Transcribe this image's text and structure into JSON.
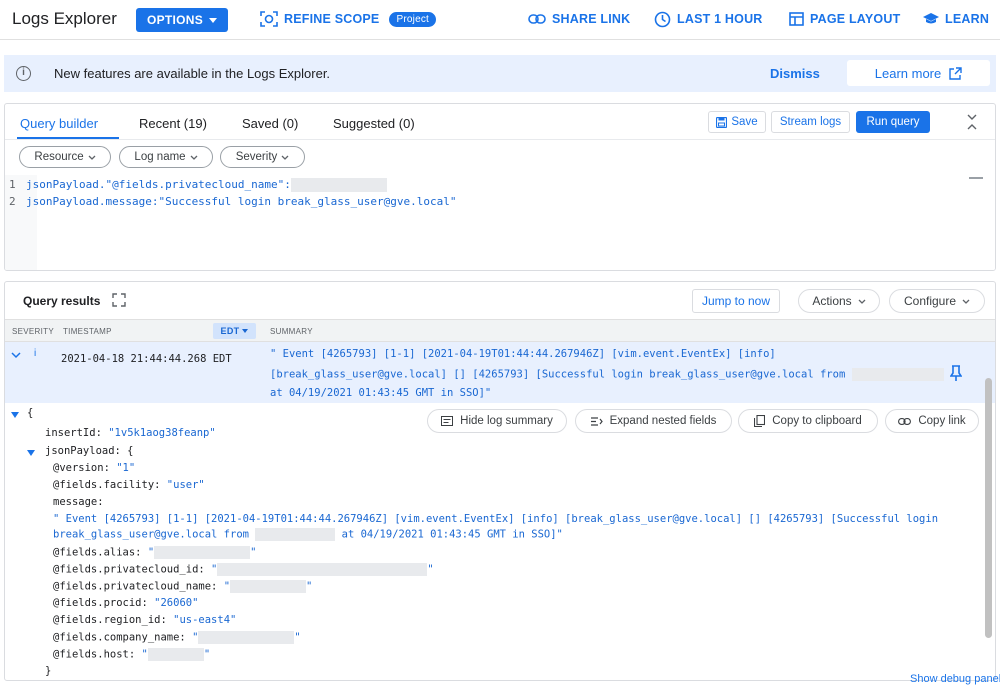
{
  "header": {
    "title": "Logs Explorer",
    "options_label": "OPTIONS",
    "refine_scope_label": "REFINE SCOPE",
    "project_chip": "Project",
    "share_link_label": "SHARE LINK",
    "time_range_label": "LAST 1 HOUR",
    "page_layout_label": "PAGE LAYOUT",
    "learn_label": "LEARN"
  },
  "banner": {
    "message": "New features are available in the Logs Explorer.",
    "dismiss_label": "Dismiss",
    "learn_more_label": "Learn more"
  },
  "query": {
    "tabs": [
      "Query builder",
      "Recent (19)",
      "Saved (0)",
      "Suggested (0)"
    ],
    "save_label": "Save",
    "stream_logs_label": "Stream logs",
    "run_query_label": "Run query",
    "filters": [
      "Resource",
      "Log name",
      "Severity"
    ],
    "lines": [
      {
        "num": "1",
        "text": "jsonPayload.\"@fields.privatecloud_name\":"
      },
      {
        "num": "2",
        "text": "jsonPayload.message:\"Successful login break_glass_user@gve.local\""
      }
    ]
  },
  "results": {
    "title": "Query results",
    "jump_to_now_label": "Jump to now",
    "actions_label": "Actions",
    "configure_label": "Configure",
    "columns": {
      "severity": "SEVERITY",
      "timestamp": "TIMESTAMP",
      "timezone": "EDT",
      "summary": "SUMMARY"
    },
    "row": {
      "timestamp": "2021-04-18 21:44:44.268 EDT",
      "summary_line1": "\" Event [4265793] [1-1] [2021-04-19T01:44:44.267946Z] [vim.event.EventEx] [info]",
      "summary_line2": "[break_glass_user@gve.local] [] [4265793] [Successful login break_glass_user@gve.local from",
      "summary_line3": "at 04/19/2021 01:43:45 GMT in SSO]\""
    },
    "detail_actions": [
      "Hide log summary",
      "Expand nested fields",
      "Copy to clipboard",
      "Copy link"
    ],
    "detail": {
      "open_brace": "{",
      "insert_id_key": "insertId:",
      "insert_id_val": "\"1v5k1aog38feanp\"",
      "json_payload_key": "jsonPayload: {",
      "version_key": "@version:",
      "version_val": "\"1\"",
      "facility_key": "@fields.facility:",
      "facility_val": "\"user\"",
      "message_key": "message:",
      "message_line1": "\" Event [4265793] [1-1] [2021-04-19T01:44:44.267946Z] [vim.event.EventEx] [info] [break_glass_user@gve.local] [] [4265793] [Successful login",
      "message_line2a": "break_glass_user@gve.local from",
      "message_line2b": "at 04/19/2021 01:43:45 GMT in SSO]\"",
      "alias_key": "@fields.alias:",
      "privatecloud_id_key": "@fields.privatecloud_id:",
      "privatecloud_name_key": "@fields.privatecloud_name:",
      "procid_key": "@fields.procid:",
      "procid_val": "\"26060\"",
      "region_key": "@fields.region_id:",
      "region_val": "\"us-east4\"",
      "company_key": "@fields.company_name:",
      "host_key": "@fields.host:",
      "close_brace": "}",
      "quote": "\""
    },
    "debug_label": "Show debug panel"
  },
  "colors": {
    "accent": "#1a73e8",
    "banner_bg": "#e8f0fe",
    "selected_row": "#e8f0fe"
  }
}
